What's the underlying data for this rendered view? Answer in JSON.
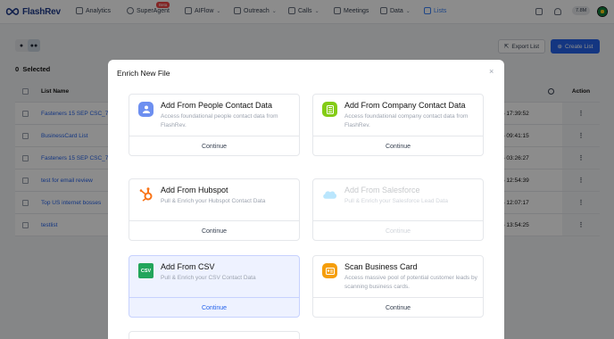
{
  "app": {
    "brand": "FlashRev"
  },
  "nav": {
    "items": [
      {
        "label": "Analytics",
        "icon": "analytics-icon"
      },
      {
        "label": "SuperAgent",
        "icon": "superagent-icon",
        "badge": "Beta"
      },
      {
        "label": "AIFlow",
        "icon": "aiflow-icon"
      },
      {
        "label": "Outreach",
        "icon": "outreach-icon"
      },
      {
        "label": "Calls",
        "icon": "phone-icon"
      },
      {
        "label": "Meetings",
        "icon": "meetings-icon"
      },
      {
        "label": "Data",
        "icon": "data-icon"
      },
      {
        "label": "Lists",
        "icon": "lists-icon"
      }
    ],
    "credits": "7.8M"
  },
  "page": {
    "selected_count": "0",
    "selected_label": "Selected",
    "export_label": "Export List",
    "create_label": "Create List",
    "columns": {
      "name": "List Name",
      "action": "Action"
    },
    "rows": [
      {
        "name": "Fasteners 15 SEP CSC_76...",
        "date": "5 17:39:52"
      },
      {
        "name": "BusinessCard List",
        "date": "5 09:41:15"
      },
      {
        "name": "Fasteners 15 SEP CSC_76...",
        "date": "5 03:26:27"
      },
      {
        "name": "test for email review",
        "date": "5 12:54:39"
      },
      {
        "name": "Top US internet bosses",
        "date": "5 12:07:17"
      },
      {
        "name": "testlist",
        "date": "5 13:54:25"
      }
    ],
    "action_glyph": "⋮"
  },
  "modal": {
    "title": "Enrich New File",
    "close_glyph": "×",
    "cards": [
      {
        "title": "Add From People Contact Data",
        "desc": "Access foundational people contact data from FlashRev.",
        "action": "Continue",
        "icon": "people-icon"
      },
      {
        "title": "Add From Company Contact Data",
        "desc": "Access foundational company contact data from FlashRev.",
        "action": "Continue",
        "icon": "company-icon"
      },
      {
        "title": "Add From Hubspot",
        "desc": "Pull & Enrich your Hubspot Contact Data",
        "action": "Continue",
        "icon": "hubspot-icon"
      },
      {
        "title": "Add From Salesforce",
        "desc": "Pull & Enrich your Salesforce Lead Data",
        "action": "Continue",
        "icon": "salesforce-icon"
      },
      {
        "title": "Add From CSV",
        "desc": "Pull & Enrich your CSV Contact Data",
        "action": "Continue",
        "icon": "csv-icon",
        "icon_text": "CSV"
      },
      {
        "title": "Scan Business Card",
        "desc": "Access massive pool of potential customer leads by scanning business cards.",
        "action": "Continue",
        "icon": "business-card-icon"
      }
    ]
  },
  "colors": {
    "accent": "#2563eb",
    "people": "#6d8ff0",
    "company": "#84cc16",
    "hubspot": "#f97316",
    "salesforce": "#7dd3fc",
    "csv": "#22a55b",
    "card_scan": "#f59e0b"
  }
}
